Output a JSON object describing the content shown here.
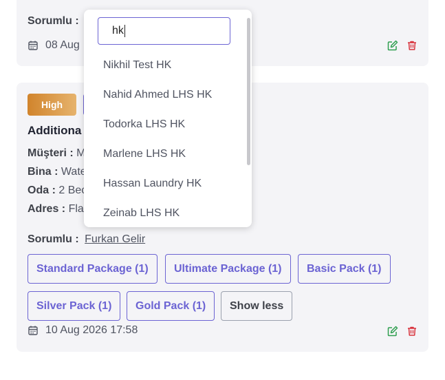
{
  "top_card": {
    "responsible_label": "Sorumlu :",
    "date": "08 Aug"
  },
  "card": {
    "priority": "High",
    "title": "Additiona",
    "fields": [
      {
        "label": "Müşteri :",
        "value": "M"
      },
      {
        "label": "Bina :",
        "value": "Wate"
      },
      {
        "label": "Oda :",
        "value": "2 Bec"
      },
      {
        "label": "Adres :",
        "value": "Fla"
      }
    ],
    "responsible_label": "Sorumlu :",
    "responsible_value": "Furkan Gelir",
    "packages": [
      "Standard Package (1)",
      "Ultimate Package (1)",
      "Basic Pack (1)",
      "Silver Pack (1)",
      "Gold Pack (1)"
    ],
    "show_less": "Show less",
    "date": "10 Aug 2026 17:58"
  },
  "dropdown": {
    "search_value": "hk",
    "options": [
      "Nikhil Test HK",
      "Nahid Ahmed LHS HK",
      "Todorka LHS HK",
      "Marlene LHS HK",
      "Hassan Laundry HK",
      "Zeinab LHS HK"
    ]
  },
  "colors": {
    "accent": "#6b63d3",
    "edit": "#2e9e4f",
    "delete": "#d8323c",
    "high_start": "#d1842c",
    "high_end": "#e6b36d"
  }
}
